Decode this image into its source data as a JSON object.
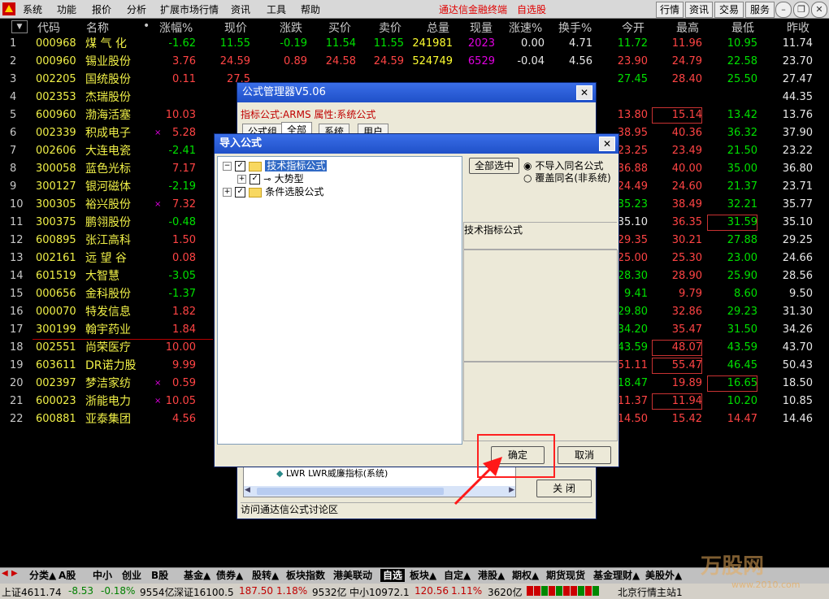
{
  "menubar": {
    "items": [
      "系统",
      "功能",
      "报价",
      "分析",
      "扩展市场行情",
      "资讯",
      "工具",
      "帮助"
    ],
    "center_text": [
      "通达信金融终端",
      "自选股"
    ],
    "right_buttons": [
      "行情",
      "资讯",
      "交易",
      "服务"
    ]
  },
  "table": {
    "headers": [
      "代码",
      "名称",
      "涨幅%",
      "现价",
      "涨跌",
      "买价",
      "卖价",
      "总量",
      "现量",
      "涨速%",
      "换手%",
      "今开",
      "最高",
      "最低",
      "昨收"
    ],
    "rows": [
      {
        "idx": "1",
        "code": "000968",
        "name": "煤 气 化",
        "mark": "",
        "chg": "-1.62",
        "price": "11.55",
        "diff": "-0.19",
        "bid": "11.54",
        "ask": "11.55",
        "vol": "241981",
        "cur": "2023",
        "spd": "0.00",
        "turn": "4.71",
        "open": "11.72",
        "high": "11.96",
        "low": "10.95",
        "prev": "11.74"
      },
      {
        "idx": "2",
        "code": "000960",
        "name": "锡业股份",
        "mark": "",
        "chg": "3.76",
        "price": "24.59",
        "diff": "0.89",
        "bid": "24.58",
        "ask": "24.59",
        "vol": "524749",
        "cur": "6529",
        "spd": "-0.04",
        "turn": "4.56",
        "open": "23.90",
        "high": "24.79",
        "low": "22.58",
        "prev": "23.70"
      },
      {
        "idx": "3",
        "code": "002205",
        "name": "国统股份",
        "mark": "",
        "chg": "0.11",
        "price": "27.5",
        "diff": "",
        "bid": "",
        "ask": "",
        "vol": "",
        "cur": "",
        "spd": "",
        "turn": "",
        "open": "27.45",
        "high": "28.40",
        "low": "25.50",
        "prev": "27.47"
      },
      {
        "idx": "4",
        "code": "002353",
        "name": "杰瑞股份",
        "mark": "",
        "chg": "",
        "price": "",
        "diff": "",
        "bid": "",
        "ask": "",
        "vol": "",
        "cur": "",
        "spd": "",
        "turn": "",
        "open": "",
        "high": "",
        "low": "",
        "prev": "44.35"
      },
      {
        "idx": "5",
        "code": "600960",
        "name": "渤海活塞",
        "mark": "",
        "chg": "10.03",
        "price": "",
        "diff": "",
        "bid": "",
        "ask": "",
        "vol": "",
        "cur": "",
        "spd": "",
        "turn": "",
        "open": "13.80",
        "high": "15.14",
        "low": "13.42",
        "prev": "13.76"
      },
      {
        "idx": "6",
        "code": "002339",
        "name": "积成电子",
        "mark": "×",
        "chg": "5.28",
        "price": "",
        "diff": "",
        "bid": "",
        "ask": "",
        "vol": "",
        "cur": "",
        "spd": "",
        "turn": "",
        "open": "38.95",
        "high": "40.36",
        "low": "36.32",
        "prev": "37.90"
      },
      {
        "idx": "7",
        "code": "002606",
        "name": "大连电瓷",
        "mark": "",
        "chg": "-2.41",
        "price": "",
        "diff": "",
        "bid": "",
        "ask": "",
        "vol": "",
        "cur": "",
        "spd": "",
        "turn": "",
        "open": "23.25",
        "high": "23.49",
        "low": "21.50",
        "prev": "23.22"
      },
      {
        "idx": "8",
        "code": "300058",
        "name": "蓝色光标",
        "mark": "",
        "chg": "7.17",
        "price": "",
        "diff": "",
        "bid": "",
        "ask": "",
        "vol": "",
        "cur": "",
        "spd": "",
        "turn": "",
        "open": "36.88",
        "high": "40.00",
        "low": "35.00",
        "prev": "36.80"
      },
      {
        "idx": "9",
        "code": "300127",
        "name": "银河磁体",
        "mark": "",
        "chg": "-2.19",
        "price": "",
        "diff": "",
        "bid": "",
        "ask": "",
        "vol": "",
        "cur": "",
        "spd": "",
        "turn": "",
        "open": "24.49",
        "high": "24.60",
        "low": "21.37",
        "prev": "23.71"
      },
      {
        "idx": "10",
        "code": "300305",
        "name": "裕兴股份",
        "mark": "×",
        "chg": "7.32",
        "price": "",
        "diff": "",
        "bid": "",
        "ask": "",
        "vol": "",
        "cur": "",
        "spd": "",
        "turn": "",
        "open": "35.23",
        "high": "38.49",
        "low": "32.21",
        "prev": "35.77"
      },
      {
        "idx": "11",
        "code": "300375",
        "name": "鹏翎股份",
        "mark": "",
        "chg": "-0.48",
        "price": "",
        "diff": "",
        "bid": "",
        "ask": "",
        "vol": "",
        "cur": "",
        "spd": "",
        "turn": "",
        "open": "35.10",
        "high": "36.35",
        "low": "31.59",
        "prev": "35.10"
      },
      {
        "idx": "12",
        "code": "600895",
        "name": "张江高科",
        "mark": "",
        "chg": "1.50",
        "price": "",
        "diff": "",
        "bid": "",
        "ask": "",
        "vol": "",
        "cur": "",
        "spd": "",
        "turn": "",
        "open": "29.35",
        "high": "30.21",
        "low": "27.88",
        "prev": "29.25"
      },
      {
        "idx": "13",
        "code": "002161",
        "name": "远 望 谷",
        "mark": "",
        "chg": "0.08",
        "price": "",
        "diff": "",
        "bid": "",
        "ask": "",
        "vol": "",
        "cur": "",
        "spd": "",
        "turn": "",
        "open": "25.00",
        "high": "25.30",
        "low": "23.00",
        "prev": "24.66"
      },
      {
        "idx": "14",
        "code": "601519",
        "name": "大智慧",
        "mark": "",
        "chg": "-3.05",
        "price": "",
        "diff": "",
        "bid": "",
        "ask": "",
        "vol": "",
        "cur": "",
        "spd": "",
        "turn": "",
        "open": "28.30",
        "high": "28.90",
        "low": "25.90",
        "prev": "28.56"
      },
      {
        "idx": "15",
        "code": "000656",
        "name": "金科股份",
        "mark": "",
        "chg": "-1.37",
        "price": "",
        "diff": "",
        "bid": "",
        "ask": "",
        "vol": "",
        "cur": "",
        "spd": "",
        "turn": "",
        "open": "9.41",
        "high": "9.79",
        "low": "8.60",
        "prev": "9.50"
      },
      {
        "idx": "16",
        "code": "000070",
        "name": "特发信息",
        "mark": "",
        "chg": "1.82",
        "price": "",
        "diff": "",
        "bid": "",
        "ask": "",
        "vol": "",
        "cur": "",
        "spd": "",
        "turn": "",
        "open": "29.80",
        "high": "32.86",
        "low": "29.23",
        "prev": "31.30"
      },
      {
        "idx": "17",
        "code": "300199",
        "name": "翰宇药业",
        "mark": "",
        "chg": "1.84",
        "price": "",
        "diff": "",
        "bid": "",
        "ask": "",
        "vol": "",
        "cur": "",
        "spd": "",
        "turn": "",
        "open": "34.20",
        "high": "35.47",
        "low": "31.50",
        "prev": "34.26"
      },
      {
        "idx": "18",
        "code": "002551",
        "name": "尚荣医疗",
        "mark": "",
        "chg": "10.00",
        "price": "",
        "diff": "",
        "bid": "",
        "ask": "",
        "vol": "",
        "cur": "",
        "spd": "",
        "turn": "",
        "open": "43.59",
        "high": "48.07",
        "low": "43.59",
        "prev": "43.70"
      },
      {
        "idx": "19",
        "code": "603611",
        "name": "DR诺力股",
        "mark": "",
        "chg": "9.99",
        "price": "",
        "diff": "",
        "bid": "",
        "ask": "",
        "vol": "",
        "cur": "",
        "spd": "",
        "turn": "",
        "open": "51.11",
        "high": "55.47",
        "low": "46.45",
        "prev": "50.43"
      },
      {
        "idx": "20",
        "code": "002397",
        "name": "梦洁家纺",
        "mark": "×",
        "chg": "0.59",
        "price": "",
        "diff": "",
        "bid": "",
        "ask": "",
        "vol": "",
        "cur": "",
        "spd": "",
        "turn": "",
        "open": "18.47",
        "high": "19.89",
        "low": "16.65",
        "prev": "18.50"
      },
      {
        "idx": "21",
        "code": "600023",
        "name": "浙能电力",
        "mark": "×",
        "chg": "10.05",
        "price": "",
        "diff": "",
        "bid": "",
        "ask": "",
        "vol": "",
        "cur": "",
        "spd": "",
        "turn": "",
        "open": "11.37",
        "high": "11.94",
        "low": "10.20",
        "prev": "10.85"
      },
      {
        "idx": "22",
        "code": "600881",
        "name": "亚泰集团",
        "mark": "",
        "chg": "4.56",
        "price": "",
        "diff": "",
        "bid": "",
        "ask": "",
        "vol": "",
        "cur": "",
        "spd": "",
        "turn": "",
        "open": "14.50",
        "high": "15.42",
        "low": "14.47",
        "prev": "14.46"
      }
    ]
  },
  "formula_manager": {
    "title": "公式管理器V5.06",
    "info": "指标公式:ARMS 属性:系统公式",
    "tabs": [
      "公式组",
      "全部",
      "系统",
      "用户"
    ],
    "list_item": "LWR  LWR威廉指标(系统)",
    "forum_link": "访问通达信公式讨论区",
    "close_button": "关  闭"
  },
  "import_dialog": {
    "title": "导入公式",
    "tree": [
      {
        "label": "技术指标公式",
        "checked": true,
        "expanded": true
      },
      {
        "label": "大势型",
        "checked": true,
        "expanded": false
      },
      {
        "label": "条件选股公式",
        "checked": true,
        "expanded": false
      }
    ],
    "select_all": "全部选中",
    "radio_options": [
      "不导入同名公式",
      "覆盖同名(非系统)"
    ],
    "selected_radio": "不导入同名公式",
    "desc_label": "技术指标公式",
    "ok_button": "确定",
    "cancel_button": "取消"
  },
  "bottom_tabs": [
    "分类▲",
    "A股",
    "中小",
    "创业",
    "B股",
    "基金▲",
    "债券▲",
    "股转▲",
    "板块指数",
    "港美联动",
    "自选",
    "板块▲",
    "自定▲",
    "港股▲",
    "期权▲",
    "期货现货",
    "基金理财▲",
    "美股外▲"
  ],
  "active_tab": "自选",
  "status": {
    "sh": "上证4611.74",
    "sh_chg": "-8.53",
    "sh_pct": "-0.18%",
    "sh_amt": "9554亿",
    "sz": "深证16100.5",
    "sz_chg": "187.50",
    "sz_pct": "1.18%",
    "sz_amt": "9532亿",
    "zx": "中小10972.1",
    "zx_chg": "120.56",
    "zx_pct": "1.11%",
    "zx_amt": "3620亿",
    "server": "北京行情主站1"
  },
  "watermark": "万股网",
  "watermark_url": "www.2010.com",
  "colors": {
    "up": "#ff4444",
    "down": "#00e000",
    "accent": "#ff0000",
    "title_bar": "#2558d8"
  }
}
